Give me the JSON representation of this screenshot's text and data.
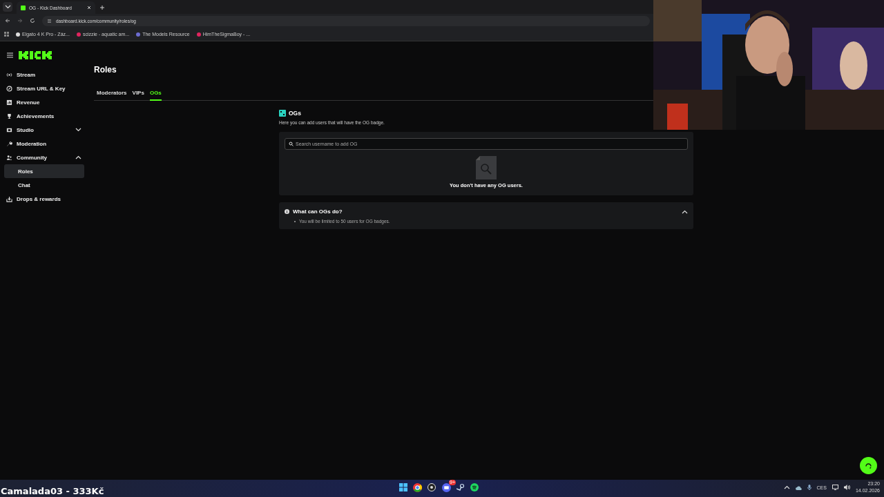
{
  "browser": {
    "tab_title": "OG - Kick Dashboard",
    "url": "dashboard.kick.com/community/roles/og",
    "bookmarks": [
      "Elgato 4 K Pro - Záz...",
      "scizzie - aquatic am...",
      "The Models Resource",
      "HimTheSigmaBoy - ..."
    ]
  },
  "sidebar": {
    "items": [
      {
        "label": "Stream",
        "selected": false
      },
      {
        "label": "Stream URL & Key",
        "selected": false
      },
      {
        "label": "Revenue",
        "selected": false
      },
      {
        "label": "Achievements",
        "selected": false
      },
      {
        "label": "Studio",
        "selected": false,
        "expanded": false
      },
      {
        "label": "Moderation",
        "selected": false
      },
      {
        "label": "Community",
        "selected": false,
        "expanded": true,
        "children": [
          {
            "label": "Roles",
            "selected": true
          },
          {
            "label": "Chat",
            "selected": false
          }
        ]
      },
      {
        "label": "Drops & rewards",
        "selected": false
      }
    ]
  },
  "page": {
    "title": "Roles",
    "tabs": [
      {
        "label": "Moderators",
        "selected": false
      },
      {
        "label": "VIPs",
        "selected": false
      },
      {
        "label": "OGs",
        "selected": true
      }
    ],
    "section": {
      "title": "OGs",
      "description": "Here you can add users that will have the OG badge.",
      "search": {
        "placeholder": "Search username to add OG"
      },
      "empty_text": "You don't have any OG users."
    },
    "faq": {
      "title": "What can OGs do?",
      "expanded": true,
      "items": [
        "You will be limited to 50 users for OG badges."
      ]
    }
  },
  "overlay_caption": "Camalada03 - 333Kč",
  "taskbar": {
    "discord_badge": "9+",
    "language": "CES",
    "time": "23:20",
    "date": "14.02.2026"
  }
}
